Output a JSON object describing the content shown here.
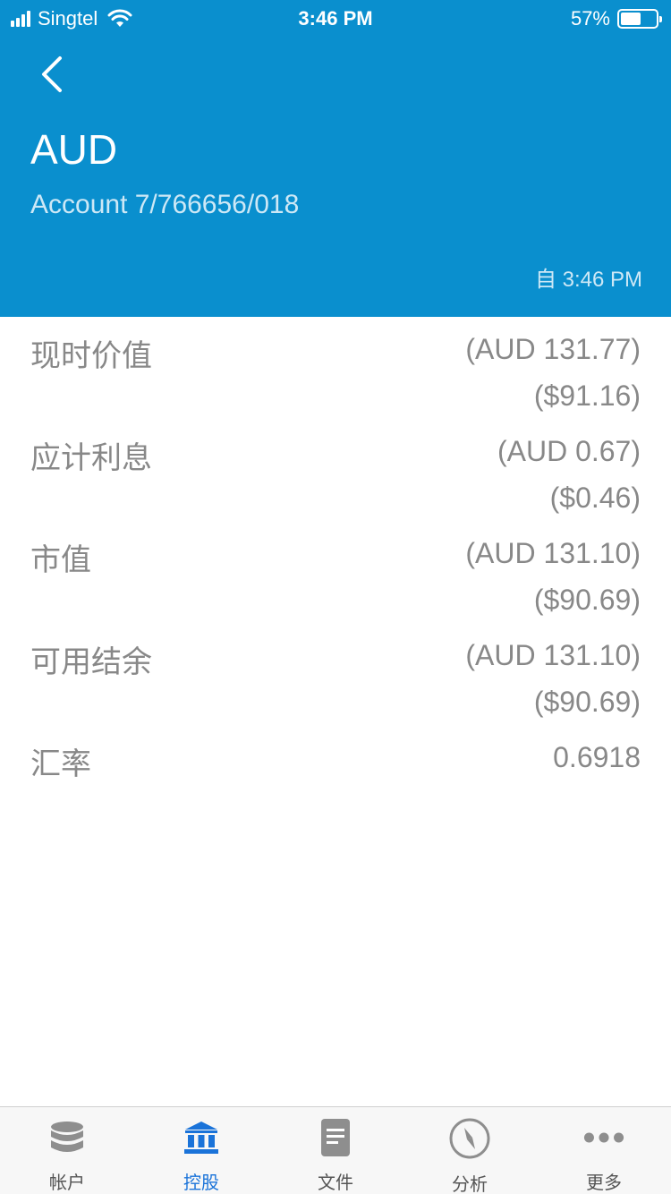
{
  "status_bar": {
    "carrier": "Singtel",
    "time": "3:46 PM",
    "battery": "57%",
    "battery_level": 0.57
  },
  "header": {
    "back_icon": "chevron-left-icon",
    "title": "AUD",
    "subtitle": "Account 7/766656/018",
    "updated": "自 3:46 PM"
  },
  "rows": [
    {
      "label": "现时价值",
      "value1": "(AUD 131.77)",
      "value2": "($91.16)"
    },
    {
      "label": "应计利息",
      "value1": "(AUD 0.67)",
      "value2": "($0.46)"
    },
    {
      "label": "市值",
      "value1": "(AUD 131.10)",
      "value2": "($90.69)"
    },
    {
      "label": "可用结余",
      "value1": "(AUD 131.10)",
      "value2": "($90.69)"
    },
    {
      "label": "汇率",
      "value1": "0.6918"
    }
  ],
  "tabs": [
    {
      "label": "帐户",
      "icon": "database-icon"
    },
    {
      "label": "控股",
      "icon": "bank-icon",
      "active": true
    },
    {
      "label": "文件",
      "icon": "document-icon"
    },
    {
      "label": "分析",
      "icon": "compass-icon"
    },
    {
      "label": "更多",
      "icon": "more-dots-icon"
    }
  ],
  "colors": {
    "header_bg": "#0a8fce",
    "active_tab": "#1a73d9",
    "inactive_icon": "#8e8e8e",
    "text_gray": "#888888"
  }
}
